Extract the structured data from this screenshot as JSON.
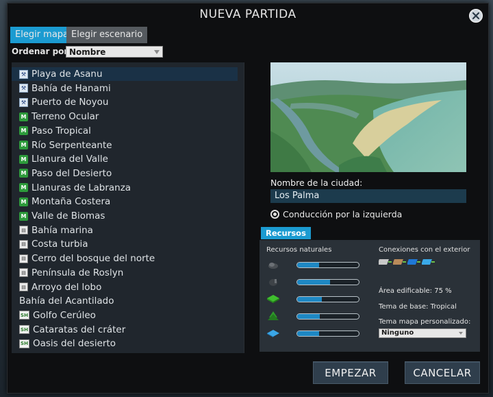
{
  "title": "NUEVA PARTIDA",
  "tabs": [
    {
      "label": "Elegir mapa",
      "active": true
    },
    {
      "label": "Elegir escenario",
      "active": false
    }
  ],
  "sort": {
    "label": "Ordenar por",
    "value": "Nombre"
  },
  "maps": [
    {
      "name": "Playa de Asanu",
      "icon": "workshop-icon",
      "selected": true
    },
    {
      "name": "Bahía de Hanami",
      "icon": "workshop-icon"
    },
    {
      "name": "Puerto de Noyou",
      "icon": "workshop-icon"
    },
    {
      "name": "Terreno Ocular",
      "icon": "map-icon"
    },
    {
      "name": "Paso Tropical",
      "icon": "map-icon"
    },
    {
      "name": "Río Serpenteante",
      "icon": "map-icon"
    },
    {
      "name": "Llanura del Valle",
      "icon": "map-icon"
    },
    {
      "name": "Paso del Desierto",
      "icon": "map-icon"
    },
    {
      "name": "Llanuras de Labranza",
      "icon": "map-icon"
    },
    {
      "name": "Montaña Costera",
      "icon": "map-icon"
    },
    {
      "name": "Valle de Biomas",
      "icon": "map-icon"
    },
    {
      "name": "Bahía marina",
      "icon": "campus-book-icon"
    },
    {
      "name": "Costa turbia",
      "icon": "campus-book-icon"
    },
    {
      "name": "Cerro del bosque del norte",
      "icon": "campus-book-icon"
    },
    {
      "name": "Península de Roslyn",
      "icon": "campus-book-icon"
    },
    {
      "name": "Arroyo del lobo",
      "icon": "campus-book-icon"
    },
    {
      "name": "Bahía del Acantilado",
      "icon": ""
    },
    {
      "name": "Golfo Cerúleo",
      "icon": "sh-icon"
    },
    {
      "name": "Cataratas del cráter",
      "icon": "sh-icon"
    },
    {
      "name": "Oasis del desierto",
      "icon": "sh-icon"
    }
  ],
  "icon_text": {
    "map": "M",
    "sh": "SH",
    "book": "▤",
    "workshop": "⚒"
  },
  "city": {
    "label": "Nombre de la ciudad:",
    "value": "Los Palma"
  },
  "left_drive": {
    "label": "Conducción por la izquierda",
    "checked": true
  },
  "resources": {
    "tab_label": "Recursos",
    "natural_label": "Recursos naturales",
    "natural": [
      {
        "icon": "ore-icon",
        "level": 0.35
      },
      {
        "icon": "oil-icon",
        "level": 0.53
      },
      {
        "icon": "fertile-land-icon",
        "level": 0.4
      },
      {
        "icon": "forest-icon",
        "level": 0.37
      },
      {
        "icon": "water-icon",
        "level": 0.35
      }
    ],
    "connections_label": "Conexiones con el exterior",
    "connections": [
      "road-icon",
      "train-icon",
      "ship-icon",
      "plane-icon"
    ],
    "buildable": "Área edificable: 75 %",
    "theme": "Tema de base: Tropical",
    "custom_theme_label": "Tema mapa personalizado:",
    "custom_theme_value": "Ninguno"
  },
  "buttons": {
    "start": "EMPEZAR",
    "cancel": "CANCELAR"
  },
  "colors": {
    "accent": "#1b9bd1",
    "bar_fill": "#1e88c4",
    "panel": "#0e0f11"
  }
}
